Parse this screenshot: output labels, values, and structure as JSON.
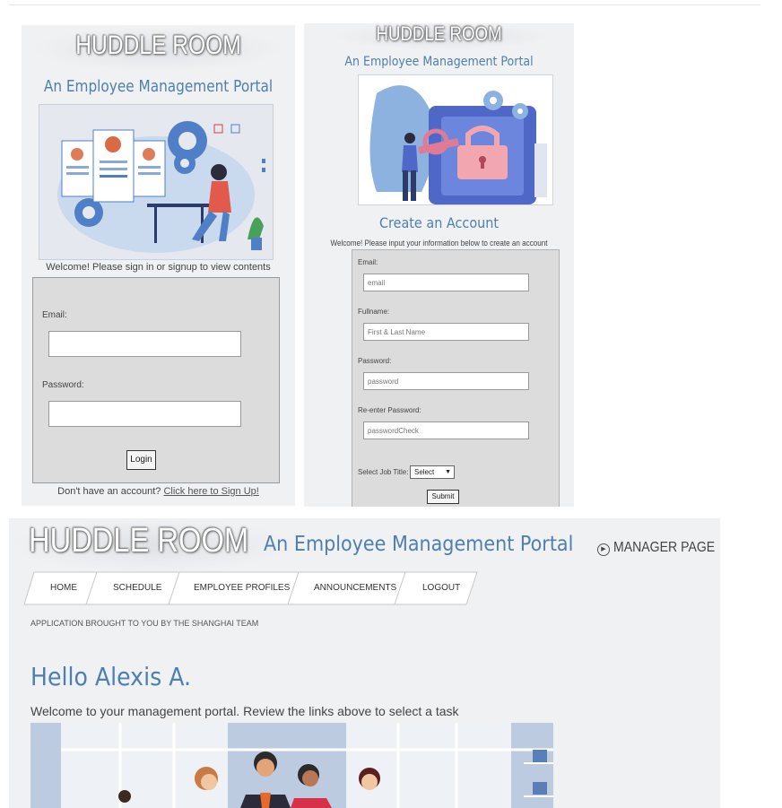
{
  "login_panel": {
    "brand": "HUDDLE ROOM",
    "subtitle": "An Employee Management Portal",
    "welcome": "Welcome! Please sign in or signup to view contents",
    "email_label": "Email:",
    "password_label": "Password:",
    "login_button": "Login",
    "signup_prompt": "Don't have an account?",
    "signup_link": "Click here to Sign Up!"
  },
  "signup_panel": {
    "brand": "HUDDLE ROOM",
    "subtitle": "An Employee Management Portal",
    "heading": "Create an Account",
    "welcome": "Welcome! Please input your information below to create an account",
    "email_label": "Email:",
    "email_placeholder": "email",
    "fullname_label": "Fullname:",
    "fullname_placeholder": "First & Last Name",
    "password_label": "Password:",
    "password_placeholder": "password",
    "reenter_label": "Re-enter Password:",
    "reenter_placeholder": "passwordCheck",
    "job_title_label": "Select Job Title:",
    "job_title_selected": "Select",
    "submit_button": "Submit"
  },
  "manager_page": {
    "brand": "HUDDLE ROOM",
    "subtitle": "An Employee Management Portal",
    "page_label": "MANAGER PAGE",
    "nav": [
      "HOME",
      "SCHEDULE",
      "EMPLOYEE PROFILES",
      "ANNOUNCEMENTS",
      "LOGOUT"
    ],
    "credit": "APPLICATION BROUGHT TO YOU BY THE SHANGHAI TEAM",
    "greeting": "Hello Alexis A.",
    "welcome": "Welcome to your management portal. Review the links above to select a task"
  },
  "colors": {
    "accent_blue": "#4f7fae",
    "panel_bg": "#f0f1f3",
    "form_bg": "#dcdcdc"
  }
}
